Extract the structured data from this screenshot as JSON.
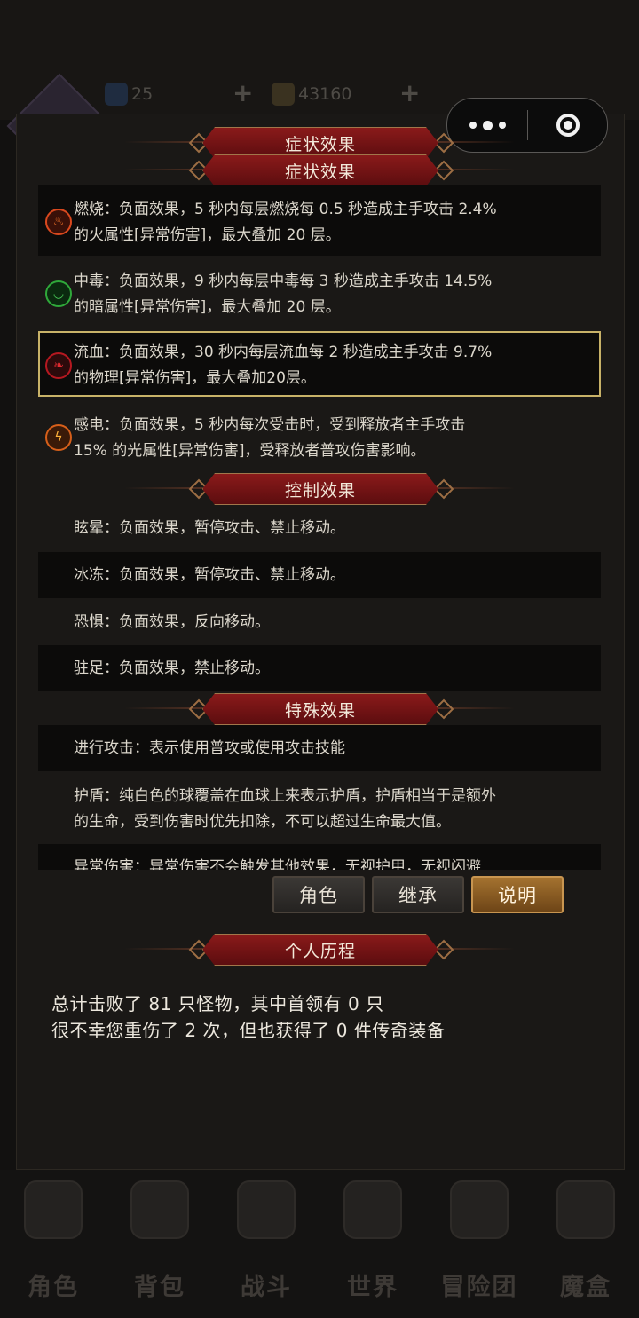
{
  "background": {
    "resources": [
      {
        "name": "gem",
        "value": "25"
      },
      {
        "name": "gold",
        "value": "43160"
      }
    ],
    "nav": [
      {
        "label": "角色",
        "icon": "helmet-icon"
      },
      {
        "label": "背包",
        "icon": "backpack-icon"
      },
      {
        "label": "战斗",
        "icon": "swords-icon"
      },
      {
        "label": "世界",
        "icon": "map-scroll-icon"
      },
      {
        "label": "冒险团",
        "icon": "castle-icon"
      },
      {
        "label": "魔盒",
        "icon": "magic-cube-icon"
      }
    ]
  },
  "sections": {
    "symptom_title_a": "症状效果",
    "symptom_title_b": "症状效果",
    "control_title": "控制效果",
    "special_title": "特殊效果",
    "history_title": "个人历程"
  },
  "symptoms": [
    {
      "icon": "burn-icon",
      "color": "#d9481e",
      "line1": "燃烧：负面效果，5 秒内每层燃烧每 0.5 秒造成主手攻击 2.4%",
      "line2": "的火属性[异常伤害]，最大叠加 20 层。"
    },
    {
      "icon": "poison-icon",
      "color": "#2fa83a",
      "line1": "中毒：负面效果，9 秒内每层中毒每 3 秒造成主手攻击 14.5%",
      "line2": "的暗属性[异常伤害]，最大叠加 20 层。"
    },
    {
      "icon": "bleed-icon",
      "color": "#b51820",
      "line1": "流血：负面效果，30 秒内每层流血每 2 秒造成主手攻击 9.7%",
      "line2": "的物理[异常伤害]，最大叠加20层。"
    },
    {
      "icon": "shock-icon",
      "color": "#d65f1a",
      "line1": "感电：负面效果，5 秒内每次受击时，受到释放者主手攻击",
      "line2": "15% 的光属性[异常伤害]，受释放者普攻伤害影响。"
    }
  ],
  "controls": [
    "眩晕：负面效果，暂停攻击、禁止移动。",
    "冰冻：负面效果，暂停攻击、禁止移动。",
    "恐惧：负面效果，反向移动。",
    "驻足：负面效果，禁止移动。"
  ],
  "specials": [
    {
      "line1": "进行攻击：表示使用普攻或使用攻击技能",
      "line2": ""
    },
    {
      "line1": "护盾：纯白色的球覆盖在血球上来表示护盾，护盾相当于是额外",
      "line2": "的生命，受到伤害时优先扣除，不可以超过生命最大值。"
    },
    {
      "line1": "异常伤害：异常伤害不会触发其他效果，无视护甲，无视闪避",
      "line2": ""
    }
  ],
  "tabs": {
    "role": "角色",
    "inherit": "继承",
    "explain": "说明"
  },
  "history": {
    "line1": "总计击败了 81 只怪物，其中首领有 0 只",
    "line2": "很不幸您重伤了 2 次，但也获得了 0 件传奇装备"
  }
}
